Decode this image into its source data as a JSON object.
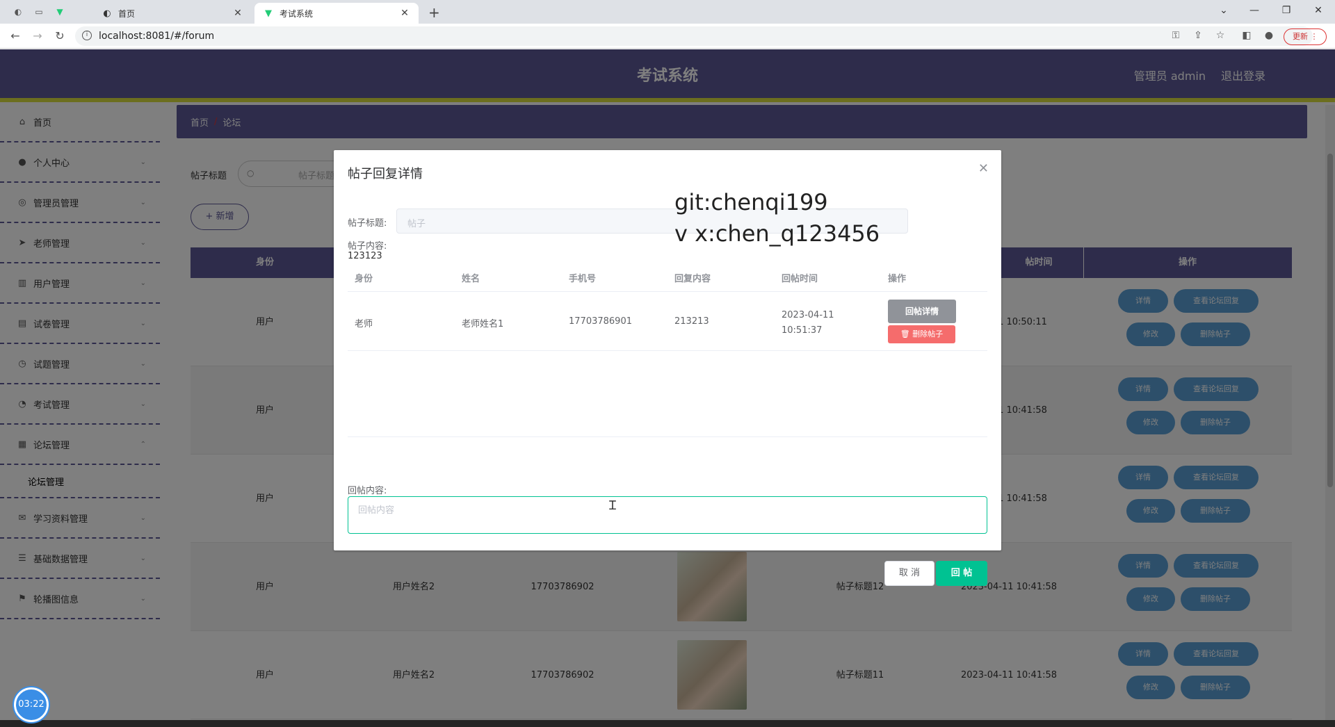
{
  "browser": {
    "tabs": [
      {
        "label": "首页",
        "active": false
      },
      {
        "label": "考试系统",
        "active": true
      }
    ],
    "url": "localhost:8081/#/forum",
    "update_label": "更新"
  },
  "app": {
    "title": "考试系统",
    "user_label": "管理员 admin",
    "logout_label": "退出登录",
    "colors": {
      "primary": "#5c5896",
      "accent_line": "#d9dd3f",
      "success": "#00c292",
      "danger": "#f56c6c",
      "info": "#909399"
    }
  },
  "sidebar": {
    "items": [
      {
        "label": "首页",
        "icon": "home-icon"
      },
      {
        "label": "个人中心",
        "icon": "user-icon"
      },
      {
        "label": "管理员管理",
        "icon": "compass-icon"
      },
      {
        "label": "老师管理",
        "icon": "send-icon"
      },
      {
        "label": "用户管理",
        "icon": "chart-icon"
      },
      {
        "label": "试卷管理",
        "icon": "paper-icon"
      },
      {
        "label": "试题管理",
        "icon": "clock-icon"
      },
      {
        "label": "考试管理",
        "icon": "gauge-icon"
      },
      {
        "label": "论坛管理",
        "icon": "grid-icon"
      },
      {
        "label": "学习资料管理",
        "icon": "mail-icon"
      },
      {
        "label": "基础数据管理",
        "icon": "sliders-icon"
      },
      {
        "label": "轮播图信息",
        "icon": "flag-icon"
      }
    ],
    "sub_item": "论坛管理"
  },
  "breadcrumb": {
    "home": "首页",
    "sep": "/",
    "current": "论坛"
  },
  "search": {
    "label": "帖子标题",
    "placeholder": "帖子标题"
  },
  "add_label": "+ 新增",
  "table": {
    "headers": {
      "identity": "身份",
      "post_time": "帖时间",
      "actions": "操作"
    },
    "rows": [
      {
        "identity": "用户",
        "name": "",
        "phone": "",
        "has_image": false,
        "title": "",
        "time": "-11 10:50:11"
      },
      {
        "identity": "用户",
        "name": "",
        "phone": "",
        "has_image": false,
        "title": "",
        "time": "-11 10:41:58"
      },
      {
        "identity": "用户",
        "name": "",
        "phone": "",
        "has_image": false,
        "title": "",
        "time": "-11 10:41:58"
      },
      {
        "identity": "用户",
        "name": "用户姓名2",
        "phone": "17703786902",
        "has_image": true,
        "title": "帖子标题12",
        "time": "2023-04-11 10:41:58"
      },
      {
        "identity": "用户",
        "name": "用户姓名2",
        "phone": "17703786902",
        "has_image": true,
        "title": "帖子标题11",
        "time": "2023-04-11 10:41:58"
      }
    ],
    "row_buttons": {
      "detail": "详情",
      "view_replies": "查看论坛回复",
      "edit": "修改",
      "delete": "删除帖子"
    }
  },
  "timer": "03:22",
  "dialog": {
    "title": "帖子回复详情",
    "watermark_line1": "git:chenqi199",
    "watermark_line2": "v x:chen_q123456",
    "post_title_label": "帖子标题:",
    "post_title_value": "帖子",
    "post_content_label": "帖子内容:",
    "post_content_value": "123123",
    "reply_table": {
      "headers": [
        "身份",
        "姓名",
        "手机号",
        "回复内容",
        "回帖时间",
        "操作"
      ],
      "rows": [
        {
          "identity": "老师",
          "name": "老师姓名1",
          "phone": "17703786901",
          "content": "213213",
          "time": "2023-04-11 10:51:37"
        }
      ],
      "detail_button": "回帖详情",
      "delete_button": "删除帖子"
    },
    "reply_label": "回帖内容:",
    "reply_placeholder": "回帖内容",
    "cancel_label": "取 消",
    "submit_label": "回 帖"
  }
}
